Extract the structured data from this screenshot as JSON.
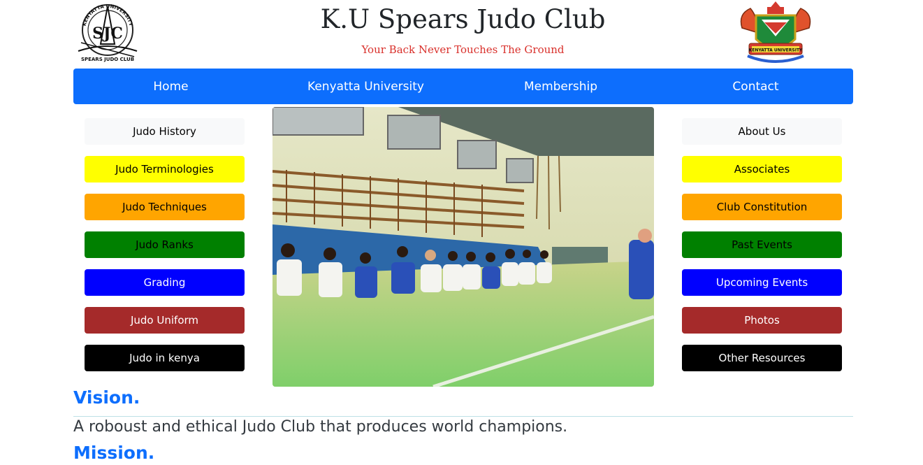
{
  "header": {
    "title": "K.U Spears Judo Club",
    "motto": "Your Back Never Touches The Ground",
    "club_logo": {
      "icon": "spears-judo-club-logo",
      "text_top": "KENYATTA UNIVERSITY",
      "text_bottom": "SPEARS JUDO CLUB",
      "monogram": "SJC"
    },
    "uni_crest": {
      "icon": "kenyatta-university-crest",
      "text": "KENYATTA UNIVERSITY"
    }
  },
  "nav": {
    "items": [
      {
        "label": "Home"
      },
      {
        "label": "Kenyatta University"
      },
      {
        "label": "Membership"
      },
      {
        "label": "Contact"
      }
    ],
    "color": "#0d6efd"
  },
  "left_menu": {
    "items": [
      {
        "label": "Judo History",
        "bg": "#f8f9fa",
        "fg": "#000000"
      },
      {
        "label": "Judo Terminologies",
        "bg": "#ffff00",
        "fg": "#000000"
      },
      {
        "label": "Judo Techniques",
        "bg": "#ffa500",
        "fg": "#000000"
      },
      {
        "label": "Judo Ranks",
        "bg": "#008000",
        "fg": "#000000"
      },
      {
        "label": "Grading",
        "bg": "#0000ff",
        "fg": "#ffffff"
      },
      {
        "label": "Judo Uniform",
        "bg": "#a52a2a",
        "fg": "#ffffff"
      },
      {
        "label": "Judo in kenya",
        "bg": "#000000",
        "fg": "#ffffff"
      }
    ]
  },
  "right_menu": {
    "items": [
      {
        "label": "About Us",
        "bg": "#f8f9fa",
        "fg": "#000000"
      },
      {
        "label": "Associates",
        "bg": "#ffff00",
        "fg": "#000000"
      },
      {
        "label": "Club Constitution",
        "bg": "#ffa500",
        "fg": "#000000"
      },
      {
        "label": "Past Events",
        "bg": "#008000",
        "fg": "#000000"
      },
      {
        "label": "Upcoming Events",
        "bg": "#0000ff",
        "fg": "#ffffff"
      },
      {
        "label": "Photos",
        "bg": "#a52a2a",
        "fg": "#ffffff"
      },
      {
        "label": "Other Resources",
        "bg": "#000000",
        "fg": "#ffffff"
      }
    ]
  },
  "main": {
    "photo": {
      "icon": "judo-dojo-photo"
    },
    "vision_heading": "Vision.",
    "vision_text": "A roboust and ethical Judo Club that produces world champions.",
    "mission_heading": "Mission."
  }
}
